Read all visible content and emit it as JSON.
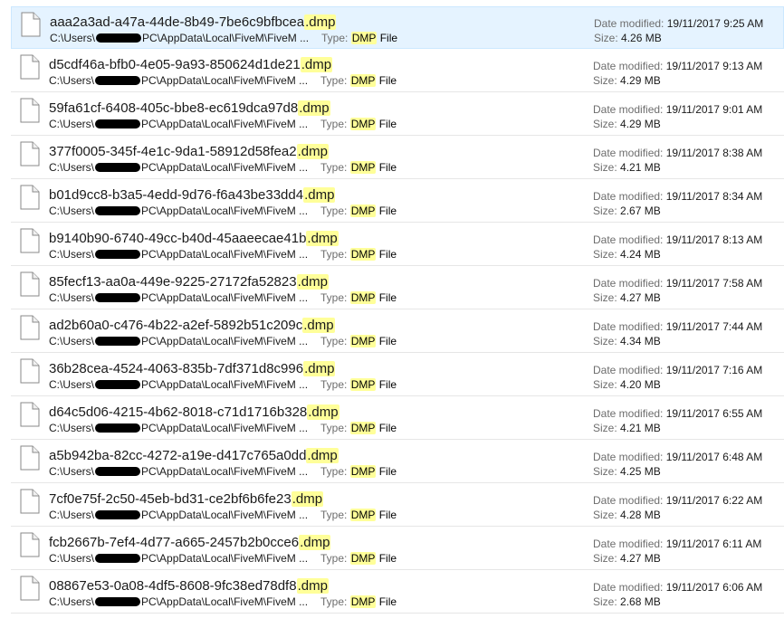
{
  "labels": {
    "date_modified": "Date modified:",
    "size": "Size:",
    "type": "Type:",
    "path_prefix": "C:\\Users\\",
    "path_suffix": "PC\\AppData\\Local\\FiveM\\FiveM ..."
  },
  "files": [
    {
      "base": "aaa2a3ad-a47a-44de-8b49-7be6c9bfbcea",
      "ext": ".dmp",
      "type_hl": "DMP",
      "type_rest": " File",
      "date": "19/11/2017 9:25 AM",
      "size": "4.26 MB"
    },
    {
      "base": "d5cdf46a-bfb0-4e05-9a93-850624d1de21",
      "ext": ".dmp",
      "type_hl": "DMP",
      "type_rest": " File",
      "date": "19/11/2017 9:13 AM",
      "size": "4.29 MB"
    },
    {
      "base": "59fa61cf-6408-405c-bbe8-ec619dca97d8",
      "ext": ".dmp",
      "type_hl": "DMP",
      "type_rest": " File",
      "date": "19/11/2017 9:01 AM",
      "size": "4.29 MB"
    },
    {
      "base": "377f0005-345f-4e1c-9da1-58912d58fea2",
      "ext": ".dmp",
      "type_hl": "DMP",
      "type_rest": " File",
      "date": "19/11/2017 8:38 AM",
      "size": "4.21 MB"
    },
    {
      "base": "b01d9cc8-b3a5-4edd-9d76-f6a43be33dd4",
      "ext": ".dmp",
      "type_hl": "DMP",
      "type_rest": " File",
      "date": "19/11/2017 8:34 AM",
      "size": "2.67 MB"
    },
    {
      "base": "b9140b90-6740-49cc-b40d-45aaeecae41b",
      "ext": ".dmp",
      "type_hl": "DMP",
      "type_rest": " File",
      "date": "19/11/2017 8:13 AM",
      "size": "4.24 MB"
    },
    {
      "base": "85fecf13-aa0a-449e-9225-27172fa52823",
      "ext": ".dmp",
      "type_hl": "DMP",
      "type_rest": " File",
      "date": "19/11/2017 7:58 AM",
      "size": "4.27 MB"
    },
    {
      "base": "ad2b60a0-c476-4b22-a2ef-5892b51c209c",
      "ext": ".dmp",
      "type_hl": "DMP",
      "type_rest": " File",
      "date": "19/11/2017 7:44 AM",
      "size": "4.34 MB"
    },
    {
      "base": "36b28cea-4524-4063-835b-7df371d8c996",
      "ext": ".dmp",
      "type_hl": "DMP",
      "type_rest": " File",
      "date": "19/11/2017 7:16 AM",
      "size": "4.20 MB"
    },
    {
      "base": "d64c5d06-4215-4b62-8018-c71d1716b328",
      "ext": ".dmp",
      "type_hl": "DMP",
      "type_rest": " File",
      "date": "19/11/2017 6:55 AM",
      "size": "4.21 MB"
    },
    {
      "base": "a5b942ba-82cc-4272-a19e-d417c765a0dd",
      "ext": ".dmp",
      "type_hl": "DMP",
      "type_rest": " File",
      "date": "19/11/2017 6:48 AM",
      "size": "4.25 MB"
    },
    {
      "base": "7cf0e75f-2c50-45eb-bd31-ce2bf6b6fe23",
      "ext": ".dmp",
      "type_hl": "DMP",
      "type_rest": " File",
      "date": "19/11/2017 6:22 AM",
      "size": "4.28 MB"
    },
    {
      "base": "fcb2667b-7ef4-4d77-a665-2457b2b0cce6",
      "ext": ".dmp",
      "type_hl": "DMP",
      "type_rest": " File",
      "date": "19/11/2017 6:11 AM",
      "size": "4.27 MB"
    },
    {
      "base": "08867e53-0a08-4df5-8608-9fc38ed78df8",
      "ext": ".dmp",
      "type_hl": "DMP",
      "type_rest": " File",
      "date": "19/11/2017 6:06 AM",
      "size": "2.68 MB"
    }
  ],
  "colors": {
    "selected_bg": "#e5f3ff",
    "highlight": "#ffff99",
    "label": "#6d6d6d"
  },
  "icon": "file-icon"
}
